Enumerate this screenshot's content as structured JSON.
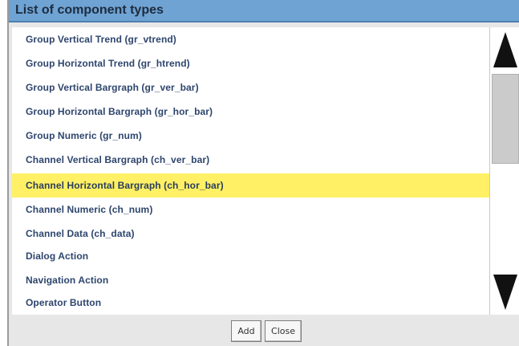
{
  "dialog": {
    "title": "List of component types"
  },
  "list": {
    "items": [
      {
        "label": "Group Vertical Trend (gr_vtrend)",
        "selected": false
      },
      {
        "label": "Group Horizontal Trend (gr_htrend)",
        "selected": false
      },
      {
        "label": "Group Vertical Bargraph (gr_ver_bar)",
        "selected": false
      },
      {
        "label": "Group Horizontal Bargraph (gr_hor_bar)",
        "selected": false
      },
      {
        "label": "Group Numeric (gr_num)",
        "selected": false
      },
      {
        "label": "Channel Vertical Bargraph (ch_ver_bar)",
        "selected": false
      },
      {
        "label": "Channel Horizontal Bargraph (ch_hor_bar)",
        "selected": true
      },
      {
        "label": "Channel Numeric (ch_num)",
        "selected": false
      },
      {
        "label": "Channel Data (ch_data)",
        "selected": false
      },
      {
        "label": "Dialog Action",
        "selected": false
      },
      {
        "label": "Navigation Action",
        "selected": false
      },
      {
        "label": "Operator Button",
        "selected": false
      }
    ]
  },
  "scrollbar": {
    "up_icon": "triangle-up-icon",
    "down_icon": "triangle-down-icon"
  },
  "buttons": {
    "add_label": "Add",
    "close_label": "Close"
  },
  "colors": {
    "title_bar": "#6fa3d3",
    "selection": "#fff065",
    "item_text": "#2d456d"
  }
}
